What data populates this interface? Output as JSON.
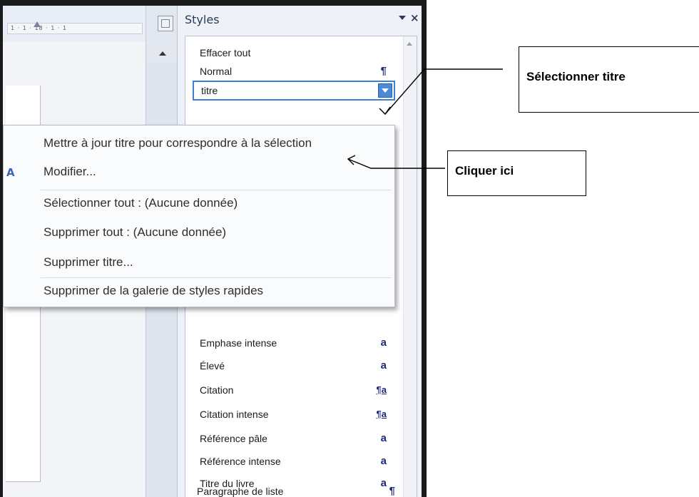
{
  "ruler": {
    "text": "1 · 1 · 18 · 1 · 1"
  },
  "styles_pane": {
    "title": "Styles",
    "dropdown_icon": "chevron-down-icon",
    "close_glyph": "×",
    "items_top": [
      {
        "label": "Effacer tout",
        "glyph": ""
      },
      {
        "label": "Normal",
        "glyph": "¶"
      },
      {
        "label": "titre",
        "glyph": "",
        "selected": true
      }
    ],
    "items_bottom": [
      {
        "label": "Emphase intense",
        "glyph": "a"
      },
      {
        "label": "Élevé",
        "glyph": "a"
      },
      {
        "label": "Citation",
        "glyph": "¶a"
      },
      {
        "label": "Citation intense",
        "glyph": "¶a"
      },
      {
        "label": "Référence pâle",
        "glyph": "a"
      },
      {
        "label": "Référence intense",
        "glyph": "a"
      },
      {
        "label": "Titre du livre",
        "glyph": "a"
      },
      {
        "label": "Paragraphe de liste",
        "glyph": "¶"
      }
    ]
  },
  "context_menu": {
    "modify_icon": "A",
    "items": [
      "Mettre à jour titre pour correspondre à la sélection",
      "Modifier...",
      "Sélectionner tout : (Aucune donnée)",
      "Supprimer tout : (Aucune donnée)",
      "Supprimer titre...",
      "Supprimer de la galerie de styles rapides"
    ]
  },
  "callouts": {
    "select_title": "Sélectionner titre",
    "click_here": "Cliquer ici"
  }
}
